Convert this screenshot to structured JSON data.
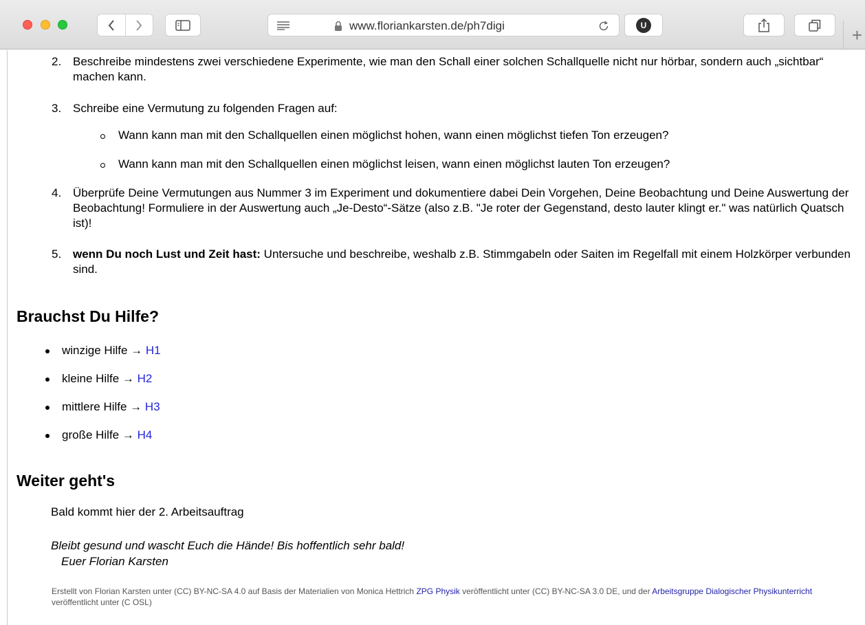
{
  "browser": {
    "url": "www.floriankarsten.de/ph7digi",
    "extension_badge": "U",
    "new_tab_label": "+"
  },
  "tasks": [
    {
      "number": "2.",
      "text": "Beschreibe mindestens zwei verschiedene Experimente, wie man den Schall einer solchen Schallquelle nicht nur hörbar, sondern auch „sichtbar“ machen kann."
    },
    {
      "number": "3.",
      "text": "Schreibe eine Vermutung zu folgenden Fragen auf:"
    },
    {
      "number": "4.",
      "text": "Überprüfe Deine Vermutungen aus Nummer 3 im Experiment und dokumentiere dabei Dein Vorgehen, Deine Beobachtung und Deine Auswertung der Beobachtung! Formuliere in der Auswertung auch „Je-Desto“-Sätze (also z.B. \"Je roter der Gegenstand, desto lauter klingt er.\" was natürlich Quatsch ist)!"
    },
    {
      "number": "5.",
      "bold": "wenn Du noch Lust und Zeit hast:",
      "text": " Untersuche und beschreibe, weshalb z.B. Stimmgabeln oder Saiten im Regelfall mit einem Holzkörper verbunden sind."
    }
  ],
  "questions": [
    "Wann kann man mit den Schallquellen einen möglichst hohen, wann einen möglichst tiefen Ton erzeugen?",
    "Wann kann man mit den Schallquellen einen möglichst leisen, wann einen möglichst lauten Ton erzeugen?"
  ],
  "help_section": {
    "heading": "Brauchst Du Hilfe?",
    "items": [
      {
        "label": "winzige Hilfe → ",
        "link": "H1"
      },
      {
        "label": "kleine Hilfe → ",
        "link": "H2"
      },
      {
        "label": "mittlere Hilfe → ",
        "link": "H3"
      },
      {
        "label": "große Hilfe → ",
        "link": "H4"
      }
    ]
  },
  "next_section": {
    "heading": "Weiter geht's",
    "text": "Bald kommt hier der 2. Arbeitsauftrag",
    "greeting_line1": "Bleibt gesund und wascht Euch die Hände! Bis hoffentlich sehr bald!",
    "greeting_line2": "Euer Florian Karsten"
  },
  "footer": {
    "part1": "Erstellt von Florian Karsten unter (CC) BY-NC-SA 4.0 auf Basis der Materialien von Monica Hettrich ",
    "link1": "ZPG Physik",
    "part2": " veröffentlicht unter (CC) BY-NC-SA 3.0 DE, und der ",
    "link2": "Arbeitsgruppe Dialogischer Physikunterricht",
    "part3": " veröffentlicht unter (C OSL)"
  },
  "colors": {
    "link": "#2323dd",
    "footer_link": "#2323aa",
    "footer_text": "#555555"
  }
}
